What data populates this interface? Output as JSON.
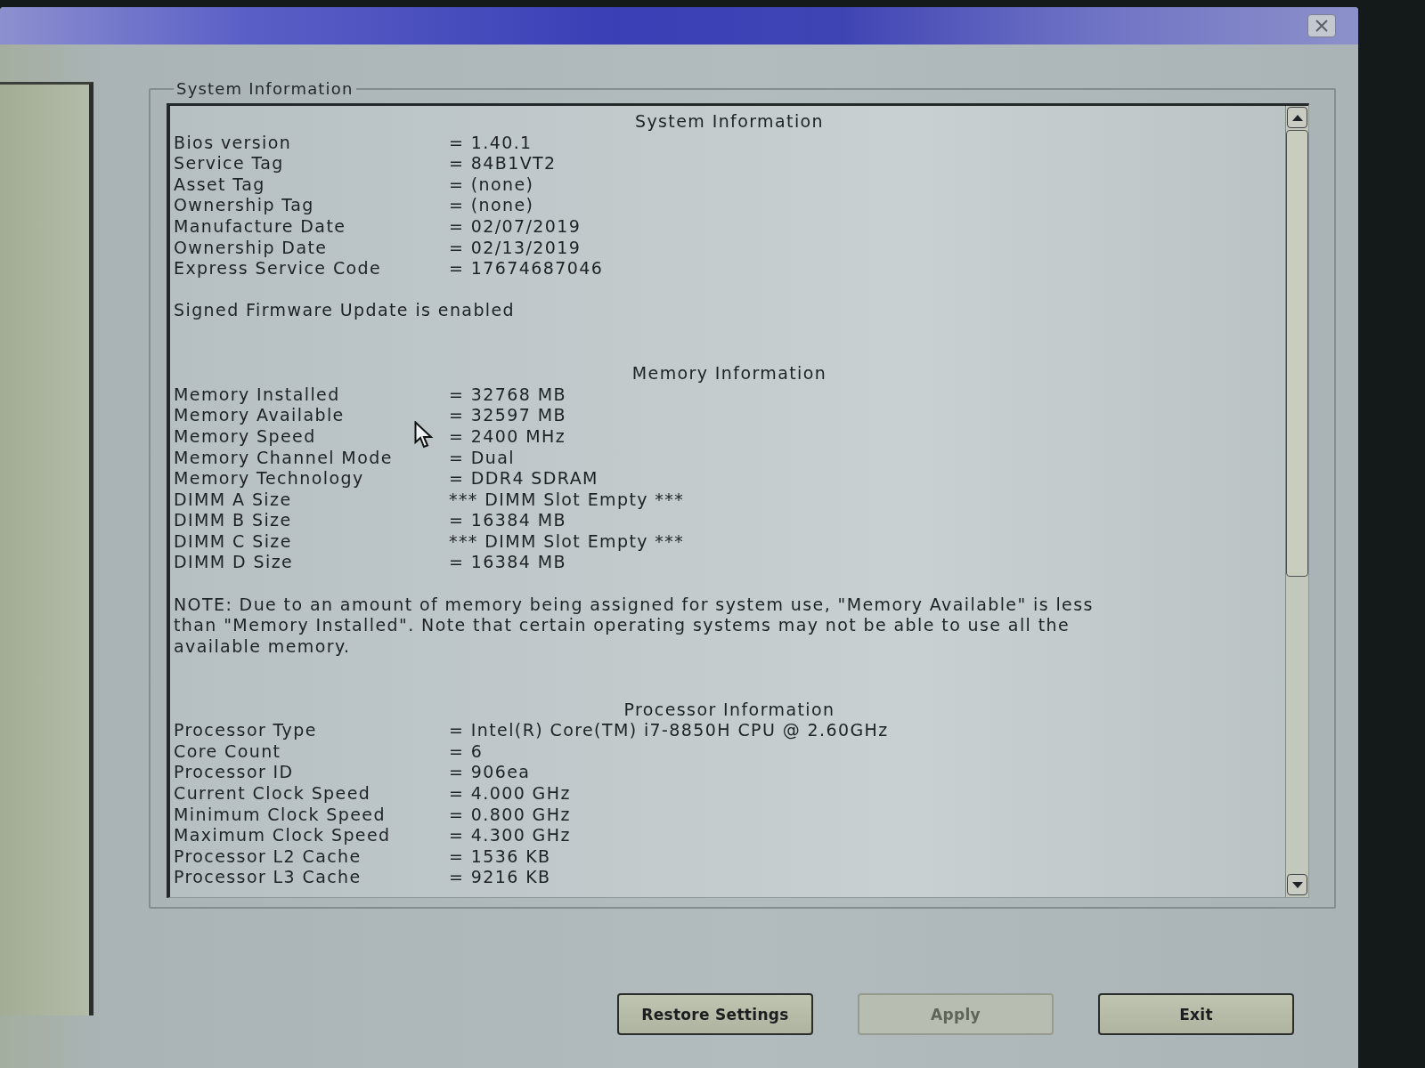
{
  "group_box": {
    "title": "System Information",
    "sections": [
      {
        "heading": "System Information",
        "fields": [
          {
            "label": "Bios version",
            "value": "= 1.40.1"
          },
          {
            "label": "Service Tag",
            "value": "= 84B1VT2"
          },
          {
            "label": "Asset Tag",
            "value": "= (none)"
          },
          {
            "label": "Ownership Tag",
            "value": "= (none)"
          },
          {
            "label": "Manufacture Date",
            "value": "= 02/07/2019"
          },
          {
            "label": "Ownership Date",
            "value": "= 02/13/2019"
          },
          {
            "label": "Express Service Code",
            "value": "= 17674687046"
          }
        ],
        "note": "Signed Firmware Update is enabled"
      },
      {
        "heading": "Memory Information",
        "fields": [
          {
            "label": "Memory Installed",
            "value": "= 32768 MB"
          },
          {
            "label": "Memory Available",
            "value": "= 32597 MB"
          },
          {
            "label": "Memory Speed",
            "value": "= 2400 MHz"
          },
          {
            "label": "Memory Channel Mode",
            "value": "= Dual"
          },
          {
            "label": "Memory Technology",
            "value": "= DDR4 SDRAM"
          },
          {
            "label": "DIMM A Size",
            "value": "*** DIMM Slot Empty ***"
          },
          {
            "label": "DIMM B Size",
            "value": "= 16384 MB"
          },
          {
            "label": "DIMM C Size",
            "value": "*** DIMM Slot Empty ***"
          },
          {
            "label": "DIMM D Size",
            "value": "= 16384 MB"
          }
        ],
        "note": "NOTE: Due to an amount of memory being assigned for system use, \"Memory Available\" is less than \"Memory Installed\". Note that certain operating systems may not be able to use all the available memory."
      },
      {
        "heading": "Processor Information",
        "fields": [
          {
            "label": "Processor Type",
            "value": "= Intel(R) Core(TM) i7-8850H CPU @ 2.60GHz"
          },
          {
            "label": "Core Count",
            "value": "= 6"
          },
          {
            "label": "Processor ID",
            "value": "= 906ea"
          },
          {
            "label": "Current Clock Speed",
            "value": "= 4.000 GHz"
          },
          {
            "label": "Minimum Clock Speed",
            "value": "= 0.800 GHz"
          },
          {
            "label": "Maximum Clock Speed",
            "value": "= 4.300 GHz"
          },
          {
            "label": "Processor L2 Cache",
            "value": "= 1536 KB"
          },
          {
            "label": "Processor L3 Cache",
            "value": "= 9216 KB"
          }
        ]
      }
    ]
  },
  "buttons": [
    {
      "label": "Restore Settings",
      "disabled": false
    },
    {
      "label": "Apply",
      "disabled": true
    },
    {
      "label": "Exit",
      "disabled": false
    }
  ]
}
